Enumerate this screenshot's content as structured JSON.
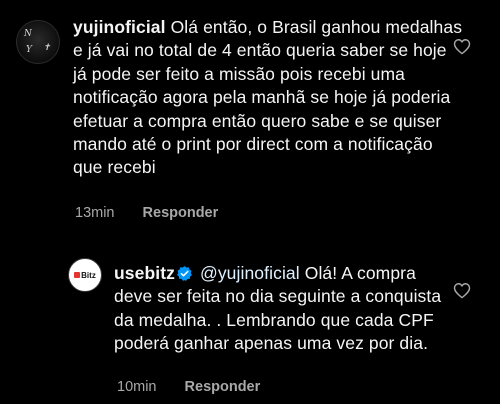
{
  "comments": [
    {
      "username": "yujinoficial",
      "avatar_text": [
        "N",
        "Y",
        "✝"
      ],
      "text": "Olá então, o Brasil ganhou medalhas e já vai no total de 4 então queria saber se hoje já pode ser feito a missão pois recebi uma notificação agora pela manhã se hoje já poderia efetuar a compra então quero sabe e se quiser mando até o print por direct com a notificação que recebi",
      "time": "13min",
      "reply_label": "Responder"
    },
    {
      "username": "usebitz",
      "avatar_text": "Bitz",
      "verified": true,
      "mention": "@yujinoficial",
      "text": "Olá! A compra deve ser feita no dia seguinte a conquista da medalha. . Lembrando que cada CPF poderá ganhar apenas uma vez por dia.",
      "time": "10min",
      "reply_label": "Responder"
    }
  ],
  "colors": {
    "background": "#000000",
    "text": "#f5f5f5",
    "meta": "#a8a8a8",
    "verified": "#0095f6",
    "mention": "#e0f1ff",
    "brand": "#e3342f"
  }
}
